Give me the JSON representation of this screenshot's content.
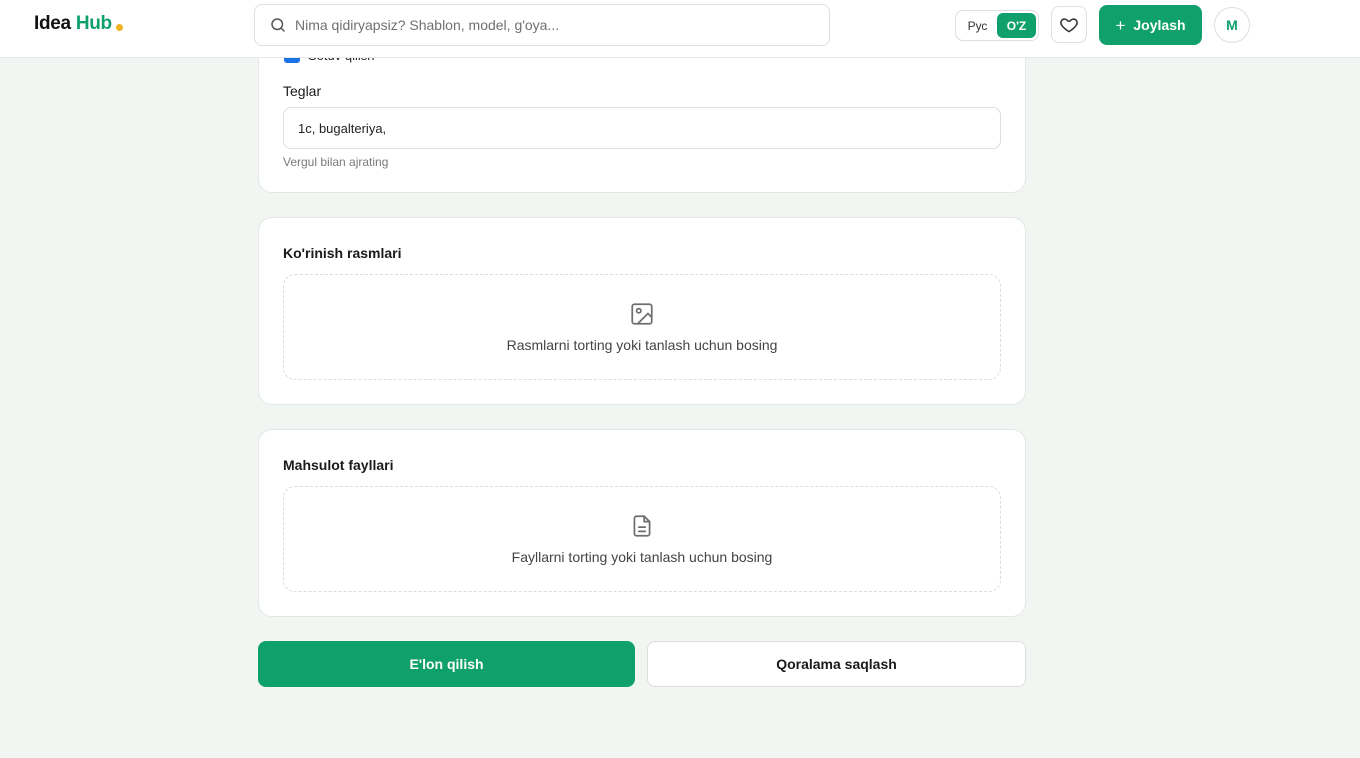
{
  "header": {
    "logo": {
      "part1": "Idea",
      "part2": "Hub",
      "accent_color": "#10a06b",
      "dot_color": "#f0b323"
    },
    "search": {
      "placeholder": "Nima qidiryapsiz? Shablon, model, g'oya...",
      "value": "",
      "icon": "search-icon"
    },
    "language": {
      "options": [
        {
          "label": "Рус",
          "active": false
        },
        {
          "label": "O'Z",
          "active": true
        }
      ]
    },
    "favorites_icon": "heart-icon",
    "post_button": {
      "icon": "plus-icon",
      "label": "Joylash"
    },
    "avatar_initial": "M"
  },
  "tags_card": {
    "partial_checkbox": {
      "label": "Sotuv qilish",
      "checked": true
    },
    "label": "Teglar",
    "input_value": "1c, bugalteriya,",
    "hint": "Vergul bilan ajrating"
  },
  "images_card": {
    "title": "Ko'rinish rasmlari",
    "dropzone_icon": "image-icon",
    "dropzone_text": "Rasmlarni torting yoki tanlash uchun bosing"
  },
  "files_card": {
    "title": "Mahsulot fayllari",
    "dropzone_icon": "file-icon",
    "dropzone_text": "Fayllarni torting yoki tanlash uchun bosing"
  },
  "actions": {
    "publish_label": "E'lon qilish",
    "draft_label": "Qoralama saqlash"
  },
  "colors": {
    "primary": "#10a06b",
    "background": "#f2f6f3",
    "checkbox": "#1a73e8"
  }
}
